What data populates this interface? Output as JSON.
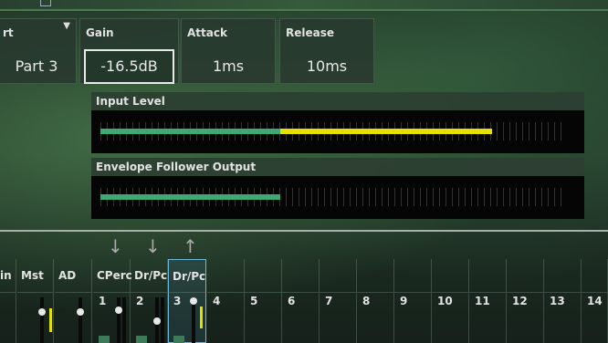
{
  "params": {
    "part": {
      "label": "rt",
      "value": "Part 3"
    },
    "gain": {
      "label": "Gain",
      "value": "-16.5dB"
    },
    "attack": {
      "label": "Attack",
      "value": "1ms"
    },
    "release": {
      "label": "Release",
      "value": "10ms"
    }
  },
  "meters": {
    "input": {
      "label": "Input Level",
      "green_fraction": 0.39,
      "yellow_fraction": 0.46,
      "colors": {
        "green": "#3fa874",
        "yellow": "#e6e000"
      }
    },
    "envelope": {
      "label": "Envelope Follower Output",
      "green_fraction": 0.39,
      "yellow_fraction": 0,
      "colors": {
        "green": "#3fa874"
      }
    }
  },
  "mixer": {
    "headers": [
      "in",
      "Mst",
      "AD",
      "CPerc",
      "Dr/Pc",
      "Dr/Pc"
    ],
    "numbers": [
      "1",
      "2",
      "3",
      "4",
      "5",
      "6",
      "7",
      "8",
      "9",
      "10",
      "11",
      "12",
      "13",
      "14"
    ],
    "arrows": [
      "down-arrow-icon",
      "down-arrow-icon",
      "up-arrow-icon"
    ],
    "selected_part": "3"
  }
}
